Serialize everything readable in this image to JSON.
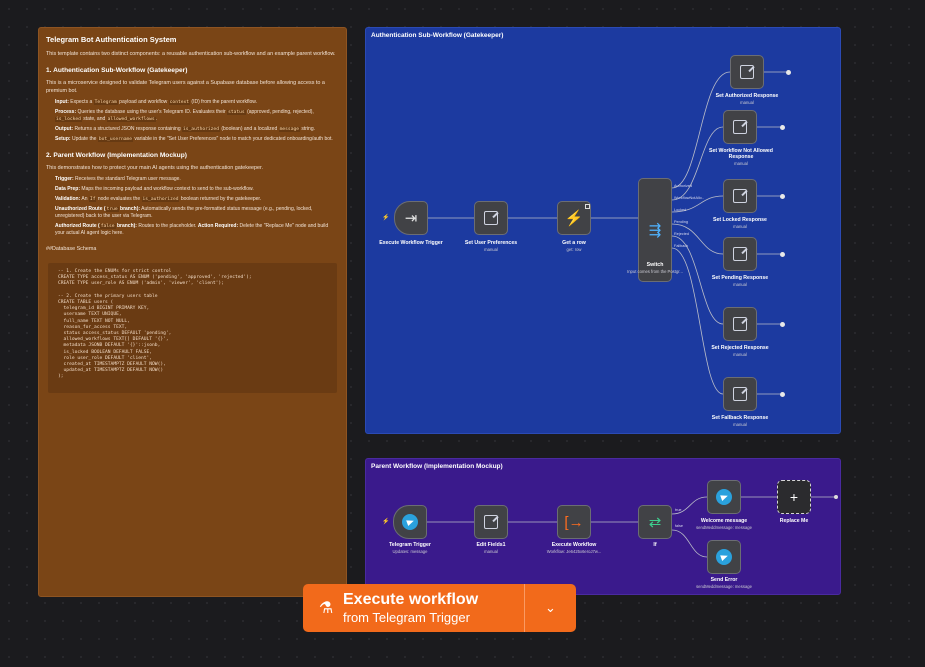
{
  "main_note": {
    "title": "Telegram Bot Authentication System",
    "intro": "This template contains two distinct components: a reusable authentication sub-workflow and an example parent workflow.",
    "section1_heading": "1. Authentication Sub-Workflow (Gatekeeper)",
    "section1_intro": "This is a microservice designed to validate Telegram users against a Supabase database before allowing access to a premium bot.",
    "input_label": "Input:",
    "input_text_a": "Expects a",
    "input_code1": "Telegram",
    "input_text_b": "payload and workflow",
    "input_code2": "context",
    "input_text_c": "(ID) from the parent workflow.",
    "process_label": "Process:",
    "process_text_a": "Queries the database using the user's Telegram ID. Evaluates their",
    "process_code1": "status",
    "process_text_b": "(approved, pending, rejected),",
    "process_code2": "is_locked",
    "process_text_c": "state, and",
    "process_code3": "allowed_workflows",
    "output_label": "Output:",
    "output_text_a": "Returns a structured JSON response containing",
    "output_code1": "is_authorized",
    "output_text_b": "(boolean) and a localized",
    "output_code2": "message",
    "output_text_c": "string.",
    "setup_label": "Setup:",
    "setup_text_a": "Update the",
    "setup_code1": "bot_username",
    "setup_text_b": "variable in the \"Set User Preferences\" node to match your dedicated onboarding/auth bot.",
    "section2_heading": "2. Parent Workflow (Implementation Mockup)",
    "section2_intro": "This demonstrates how to protect your main AI agents using the authentication gatekeeper.",
    "trigger_label": "Trigger:",
    "trigger_text": "Receives the standard Telegram user message.",
    "dataprep_label": "Data Prep:",
    "dataprep_text": "Maps the incoming payload and workflow context to send to the sub-workflow.",
    "validation_label": "Validation:",
    "validation_text_a": "An",
    "validation_code1": "If",
    "validation_text_b": "node evaluates the",
    "validation_code2": "is_authorized",
    "validation_text_c": "boolean returned by the gatekeeper.",
    "unauth_label": "Unauthorized Route (",
    "unauth_code": "true",
    "unauth_label2": "branch):",
    "unauth_text": "Automatically sends the pre-formatted status message (e.g., pending, locked, unregistered) back to the user via Telegram.",
    "auth_label": "Authorized Route (",
    "auth_code": "false",
    "auth_label2": "branch):",
    "auth_text_a": "Routes to the placeholder.",
    "auth_action_label": "Action Required:",
    "auth_text_b": "Delete the \"Replace Me\" node and build your actual AI agent logic here.",
    "schema_heading": "##Database Schema",
    "code_lines": [
      "-- 1. Create the ENUMs for strict control",
      "CREATE TYPE access_status AS ENUM ('pending', 'approved', 'rejected');",
      "CREATE TYPE user_role AS ENUM ('admin', 'viewer', 'client');",
      "",
      "-- 2. Create the primary users table",
      "CREATE TABLE users (",
      "  telegram_id BIGINT PRIMARY KEY,",
      "  username TEXT UNIQUE,",
      "  full_name TEXT NOT NULL,",
      "  reason_for_access TEXT,",
      "  status access_status DEFAULT 'pending',",
      "  allowed_workflows TEXT[] DEFAULT '{}',",
      "  metadata JSONB DEFAULT '{}'::jsonb,",
      "  is_locked BOOLEAN DEFAULT FALSE,",
      "  role user_role DEFAULT 'client',",
      "  created_at TIMESTAMPTZ DEFAULT NOW(),",
      "  updated_at TIMESTAMPTZ DEFAULT NOW()",
      ");"
    ]
  },
  "auth_note": {
    "title": "Authentication Sub-Workflow (Gatekeeper)"
  },
  "parent_note": {
    "title": "Parent Workflow (Implementation Mockup)"
  },
  "auth_nodes": {
    "execute_trigger": {
      "label": "Execute Workflow Trigger",
      "sub": ""
    },
    "set_prefs": {
      "label": "Set User Preferences",
      "sub": "manual"
    },
    "get_row": {
      "label": "Get a row",
      "sub": "get: row"
    },
    "switch": {
      "label": "Switch",
      "sub": "Input comes from the Postgr..."
    },
    "set_authorized": {
      "label": "Set Authorized Response",
      "sub": "manual"
    },
    "set_not_allowed": {
      "label": "Set Workflow Not Allowed Response",
      "sub": "manual"
    },
    "set_locked": {
      "label": "Set Locked Response",
      "sub": "manual"
    },
    "set_pending": {
      "label": "Set Pending Response",
      "sub": "manual"
    },
    "set_rejected": {
      "label": "Set Rejected Response",
      "sub": "manual"
    },
    "set_fallback": {
      "label": "Set Fallback Response",
      "sub": "manual"
    }
  },
  "switch_outputs": [
    "Authorized",
    "WorkflowNotAllo..",
    "Locked",
    "Pending",
    "Rejected",
    "Fallback"
  ],
  "parent_nodes": {
    "telegram_trigger": {
      "label": "Telegram Trigger",
      "sub": "Updates: message"
    },
    "edit_fields": {
      "label": "Edit Fields1",
      "sub": "manual"
    },
    "execute_workflow": {
      "label": "Execute Workflow",
      "sub": "Workflow: Je6425x6eroJ7w..."
    },
    "if_node": {
      "label": "If",
      "sub": ""
    },
    "welcome": {
      "label": "Welcome message",
      "sub": "sendMeddmessage: message"
    },
    "replace_me": {
      "label": "Replace Me",
      "sub": ""
    },
    "send_error": {
      "label": "Send Error",
      "sub": "sendMeddmessage: message"
    }
  },
  "if_outputs": [
    "true",
    "false"
  ],
  "execute_button": {
    "line1": "Execute workflow",
    "line2": "from Telegram Trigger"
  },
  "colors": {
    "auth_bg": "#1c3aa0",
    "parent_bg": "#3a1a8c",
    "note_bg": "#7a4516",
    "accent": "#f26a1b",
    "telegram": "#2aa1dd",
    "supabase": "#3ecf8e"
  },
  "icons": {
    "trigger": "arrow-into-box-icon",
    "edit": "pencil-square-icon",
    "supabase": "supabase-bolt-icon",
    "switch": "branch-arrows-icon",
    "telegram": "telegram-plane-icon",
    "execute": "bracket-arrow-icon",
    "if": "if-branch-icon",
    "plus": "plus-icon",
    "flask": "flask-icon",
    "chevron": "chevron-down-icon"
  }
}
